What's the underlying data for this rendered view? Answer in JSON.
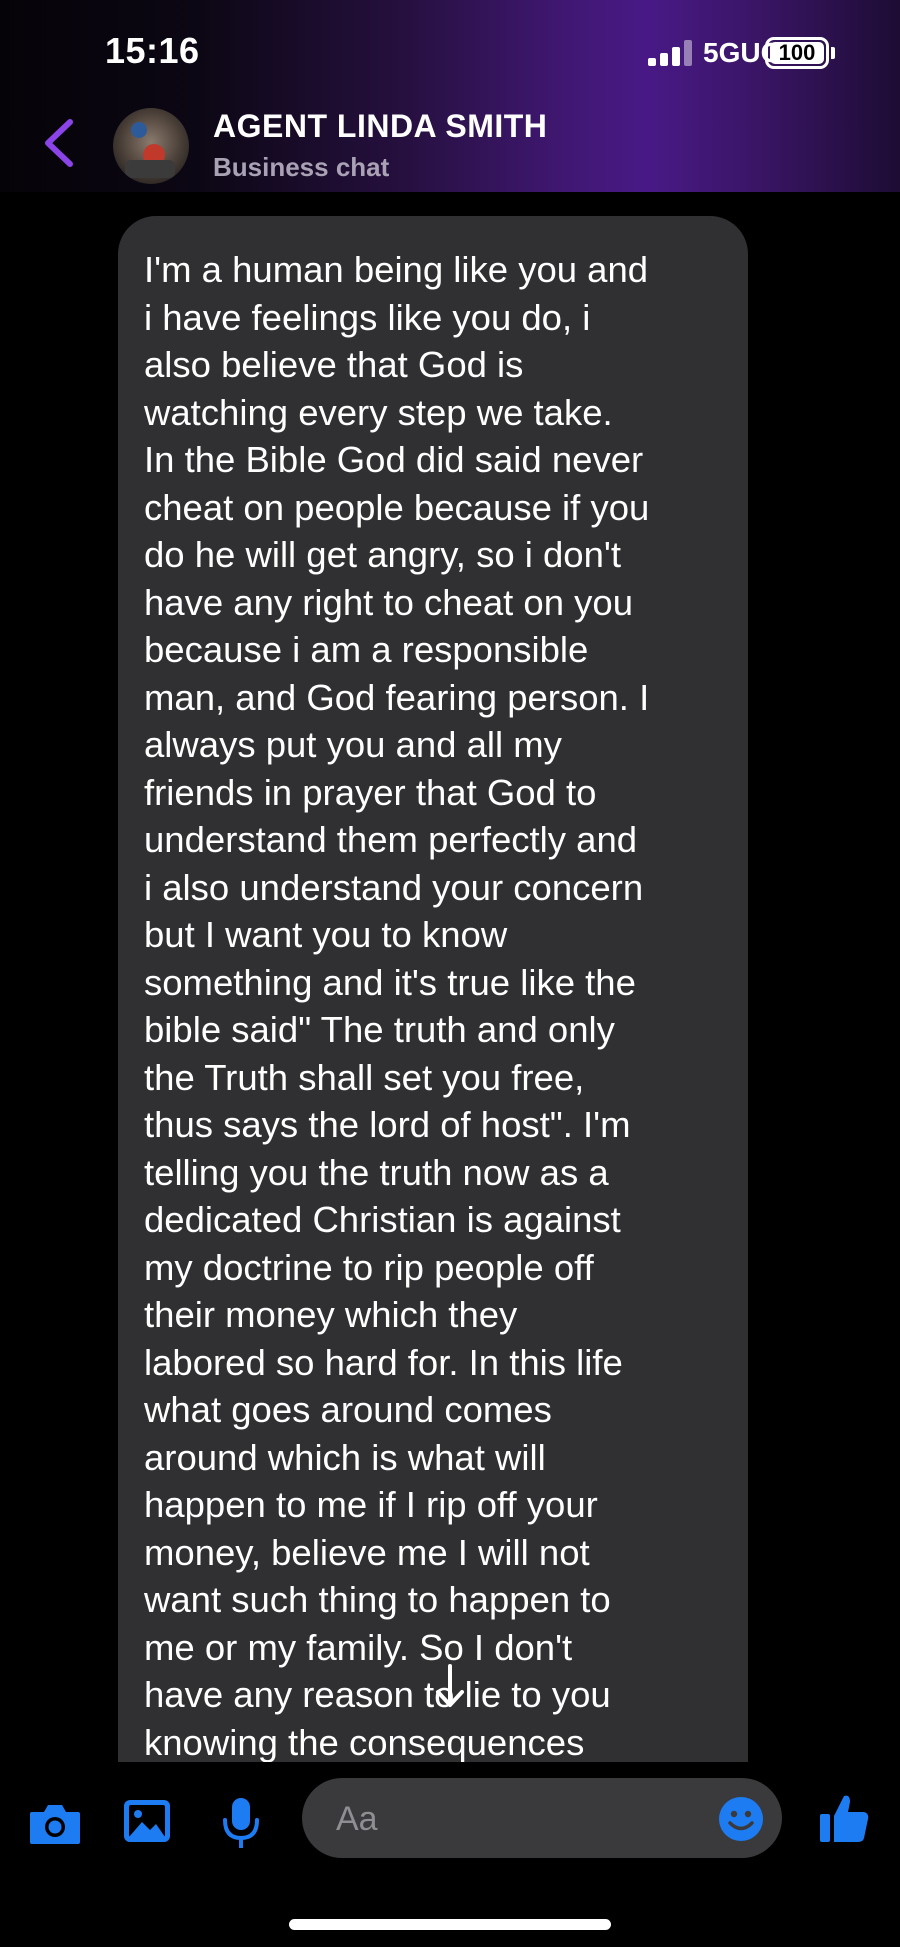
{
  "status_bar": {
    "time": "15:16",
    "network": "5GUC",
    "battery": "100"
  },
  "header": {
    "contact_name": "AGENT LINDA SMITH",
    "subtitle": "Business chat"
  },
  "message": {
    "text": "I'm a human being like you and\ni have feelings like you do, i\nalso believe that God is\nwatching every step we take.\nIn the Bible God did said never\ncheat on people because if you\ndo he will get angry, so i don't\nhave any right to cheat on you\nbecause i am a responsible\nman, and God fearing person. I\nalways put you and all my\nfriends in prayer that God to\nunderstand them perfectly and\ni also understand your concern\nbut I want you to know\nsomething and it's true like the\nbible said\" The truth and only\nthe Truth shall set you free,\nthus says the lord of host\". I'm\ntelling you the truth now as a\ndedicated Christian is against\nmy doctrine to rip people off\ntheir money which they\nlabored so hard for. In this life\nwhat goes around comes\naround which is what will\nhappen to me if I rip off your\nmoney, believe me I will not\nwant such thing to happen to\nme or my family. So I don't\nhave any reason to lie to you\nknowing the consequences"
  },
  "composer": {
    "placeholder": "Aa"
  },
  "colors": {
    "accent": "#8a44e8",
    "action_blue": "#1e7cf2",
    "bubble": "#303033",
    "input": "#3a3a3c"
  },
  "icons": {
    "back": "chevron-left-icon",
    "camera": "camera-icon",
    "gallery": "image-icon",
    "mic": "microphone-icon",
    "emoji": "smiley-icon",
    "like": "thumbs-up-icon",
    "scroll": "arrow-down-icon"
  }
}
